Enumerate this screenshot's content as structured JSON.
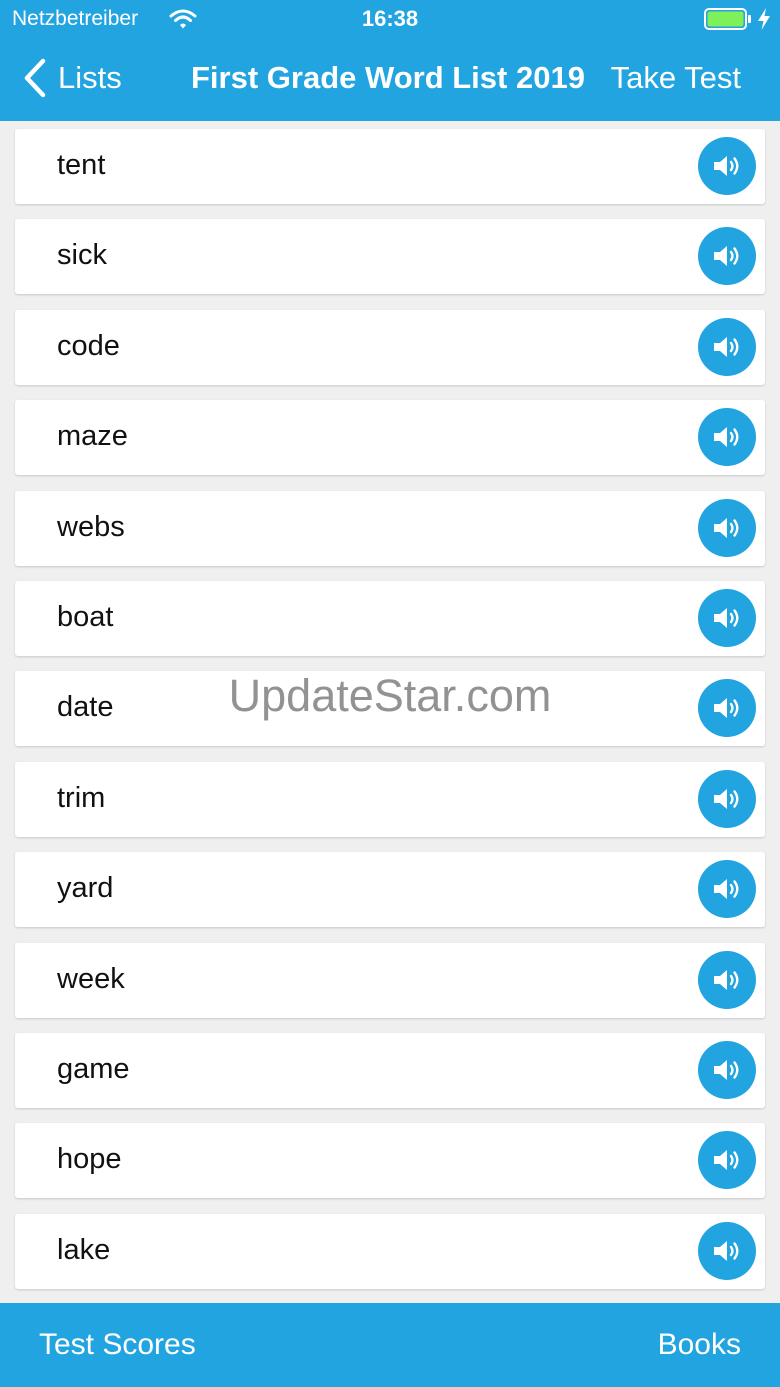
{
  "status_bar": {
    "carrier": "Netzbetreiber",
    "time": "16:38",
    "battery_color": "#7ef05a"
  },
  "nav": {
    "back_label": "Lists",
    "title": "First Grade Word List 2019",
    "action_label": "Take Test"
  },
  "words": [
    "tent",
    "sick",
    "code",
    "maze",
    "webs",
    "boat",
    "date",
    "trim",
    "yard",
    "week",
    "game",
    "hope",
    "lake"
  ],
  "row_icon": "speaker-icon",
  "watermark": "UpdateStar.com",
  "tabbar": {
    "left_label": "Test Scores",
    "right_label": "Books"
  },
  "colors": {
    "accent": "#22a4e0",
    "background": "#efefef",
    "row": "#ffffff"
  }
}
